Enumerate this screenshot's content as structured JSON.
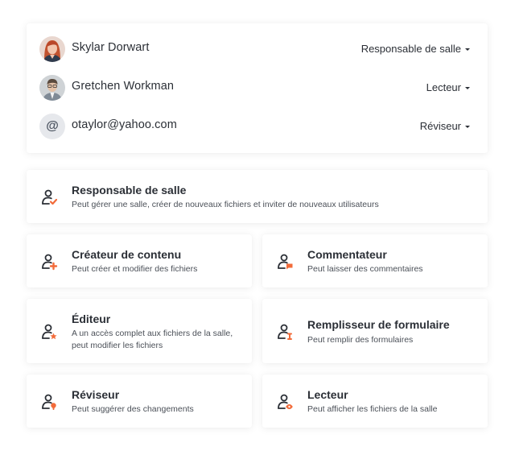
{
  "members": [
    {
      "name": "Skylar Dorwart",
      "role": "Responsable de salle",
      "avatar": "photo-avatar-woman"
    },
    {
      "name": "Gretchen Workman",
      "role": "Lecteur",
      "avatar": "photo-avatar-man"
    },
    {
      "name": "otaylor@yahoo.com",
      "role": "Réviseur",
      "avatar": "at-sign-icon",
      "avatar_glyph": "@"
    }
  ],
  "roles": [
    {
      "title": "Responsable de salle",
      "description": "Peut gérer une salle, créer de nouveaux fichiers et inviter de nouveaux utilisateurs",
      "icon": "user-check-icon"
    },
    {
      "title": "Créateur de contenu",
      "description": "Peut créer et modifier des fichiers",
      "icon": "user-plus-icon"
    },
    {
      "title": "Commentateur",
      "description": "Peut laisser des commentaires",
      "icon": "user-comment-icon"
    },
    {
      "title": "Éditeur",
      "description": "A un accès complet aux fichiers de la salle, peut modifier les fichiers",
      "icon": "user-star-icon"
    },
    {
      "title": "Remplisseur de formulaire",
      "description": "Peut remplir des formulaires",
      "icon": "user-form-icon"
    },
    {
      "title": "Réviseur",
      "description": "Peut suggérer des changements",
      "icon": "user-review-icon"
    },
    {
      "title": "Lecteur",
      "description": "Peut afficher les fichiers de la salle",
      "icon": "user-eye-icon"
    }
  ],
  "colors": {
    "accent": "#f26b3a",
    "text": "#2b2f36",
    "muted": "#4b5058"
  }
}
